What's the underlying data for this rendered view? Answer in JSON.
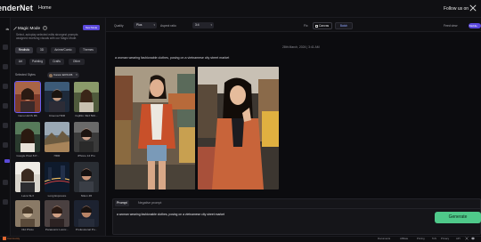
{
  "header": {
    "brand": "enderNet",
    "nav_home": "Home",
    "follow": "Follow us on"
  },
  "rail": [
    {
      "label": "ds"
    },
    {
      "label": ""
    },
    {
      "label": ""
    },
    {
      "label": ""
    },
    {
      "label": ""
    },
    {
      "label": ""
    }
  ],
  "panel": {
    "title": "Magic Mode",
    "badge": "New Mode",
    "description": "Select, autoplay selected edits strongest prompts assigned receiving visuals with our Magic Mode.",
    "chips": [
      "Realistic",
      "3D",
      "Anime/Comic",
      "Themes",
      "Art",
      "Painting",
      "Crafts",
      "Other"
    ],
    "selected_label": "Selected Styles",
    "selected_style": "Canon EOS R6",
    "tiles": [
      {
        "label": "Canon EOS R6"
      },
      {
        "label": "Cinema HDR"
      },
      {
        "label": "Fujifilm XE3 500..."
      },
      {
        "label": "Google Pixel 8 P..."
      },
      {
        "label": "HDR"
      },
      {
        "label": "iPhone 14 Pro"
      },
      {
        "label": "Leica SL3"
      },
      {
        "label": "Long Exposure"
      },
      {
        "label": "Nikon Z6"
      },
      {
        "label": "Old Photo"
      },
      {
        "label": "Panasonic Lumix..."
      },
      {
        "label": "Professional Po..."
      }
    ]
  },
  "settings": {
    "quality_label": "Quality",
    "quality_value": "Plus",
    "aspect_label": "Aspect ratio",
    "aspect_value": "3:4",
    "fix_label": "Fix",
    "canvas_label": "Canvas",
    "mode_label": "Batch",
    "feed_label": "Feed view",
    "toggle_label": "Mobile"
  },
  "main": {
    "timestamp": "28th March, 2024 | 3:41 AM",
    "prompt_echo": "a woman wearing fashionable clothes, posing on a vietnamese city street market"
  },
  "prompt": {
    "tab_prompt": "Prompt",
    "tab_negative": "Negative prompt",
    "text": "a woman wearing fashionable clothes, posing on a vietnamese city street market",
    "generate": "Generate"
  },
  "footer": {
    "logo_text": "Community",
    "links": [
      "Documents",
      "Affiliate",
      "Pricing",
      "ToS",
      "Privacy",
      "API"
    ],
    "colors": {
      "accent": "#5a48dc",
      "generate": "#4fc98a"
    }
  }
}
